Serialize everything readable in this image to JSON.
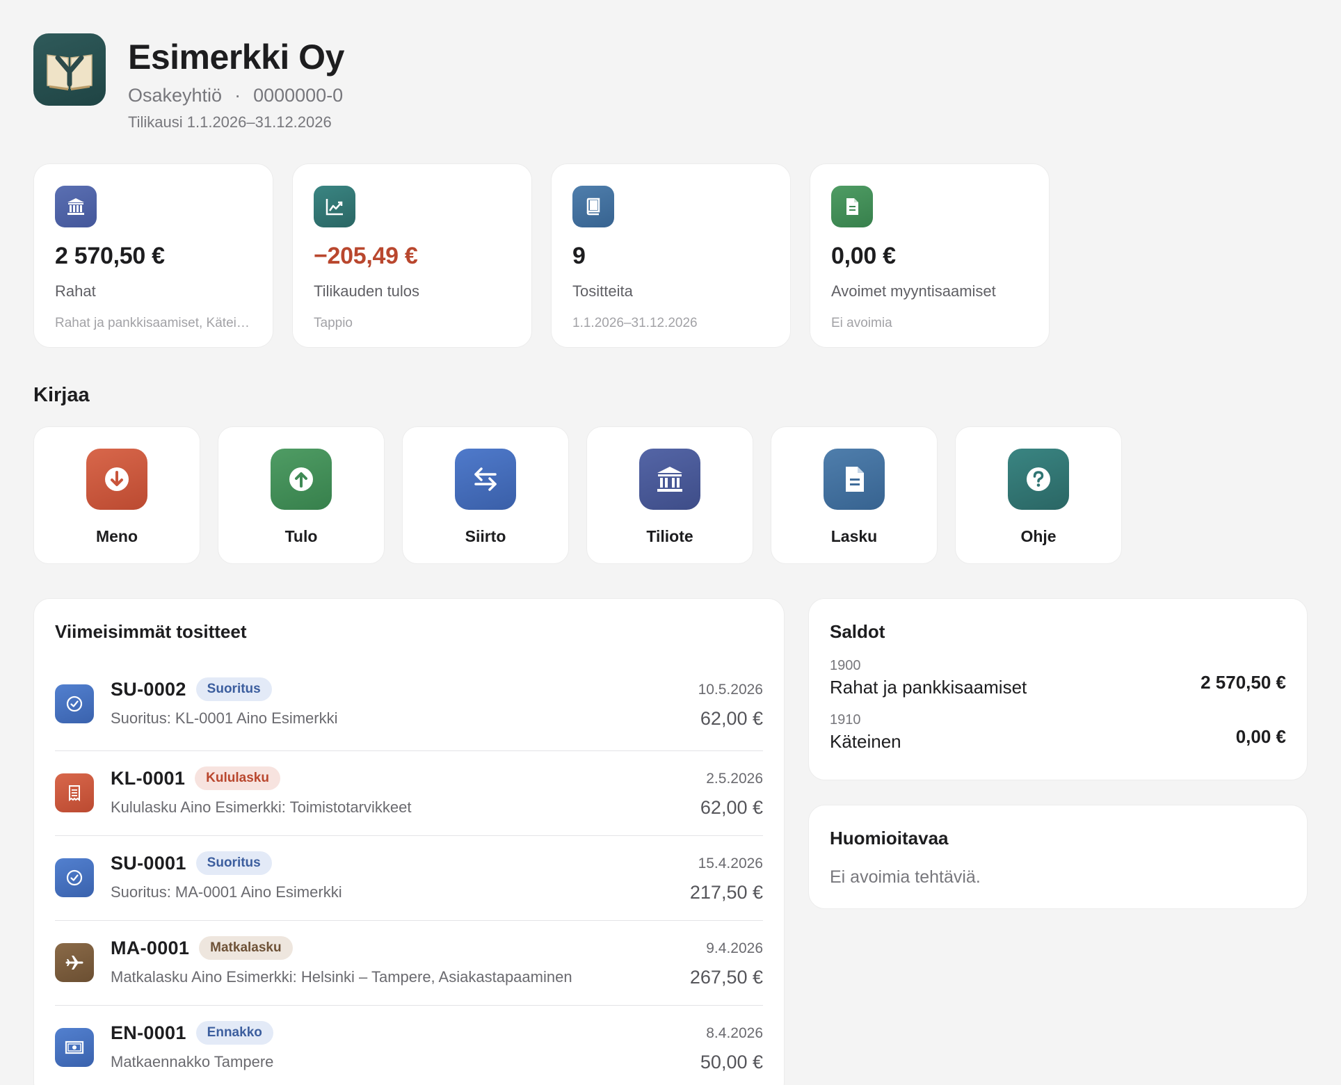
{
  "company": {
    "name": "Esimerkki Oy",
    "form": "Osakeyhtiö",
    "separator": "·",
    "business_id": "0000000-0",
    "period": "Tilikausi 1.1.2026–31.12.2026"
  },
  "stats": [
    {
      "icon": "bank-icon",
      "color": "#4a5fa0",
      "value": "2 570,50 €",
      "label": "Rahat",
      "sub": "Rahat ja pankkisaamiset, Käteinen"
    },
    {
      "icon": "chart-icon",
      "color": "#2f7472",
      "value": "−205,49 €",
      "label": "Tilikauden tulos",
      "sub": "Tappio"
    },
    {
      "icon": "book-icon",
      "color": "#3f6c9a",
      "value": "9",
      "label": "Tositteita",
      "sub": "1.1.2026–31.12.2026"
    },
    {
      "icon": "document-icon",
      "color": "#3f8a55",
      "value": "0,00 €",
      "label": "Avoimet myyntisaamiset",
      "sub": "Ei avoimia"
    }
  ],
  "actions_title": "Kirjaa",
  "actions": [
    {
      "label": "Meno",
      "icon": "arrow-down-icon",
      "color": "#c9553b"
    },
    {
      "label": "Tulo",
      "icon": "arrow-up-icon",
      "color": "#3f8a55"
    },
    {
      "label": "Siirto",
      "icon": "transfer-icon",
      "color": "#4169b5"
    },
    {
      "label": "Tiliote",
      "icon": "bank-icon",
      "color": "#4a5794"
    },
    {
      "label": "Lasku",
      "icon": "document-icon",
      "color": "#3f6c9a"
    },
    {
      "label": "Ohje",
      "icon": "question-icon",
      "color": "#2f7472"
    }
  ],
  "recent": {
    "title": "Viimeisimmät tositteet",
    "items": [
      {
        "code": "SU-0002",
        "badge": "Suoritus",
        "badge_style": "blue",
        "icon": "check-circle-icon",
        "color": "#4169b5",
        "desc": "Suoritus: KL-0001 Aino Esimerkki",
        "date": "10.5.2026",
        "amount": "62,00 €"
      },
      {
        "code": "KL-0001",
        "badge": "Kululasku",
        "badge_style": "red",
        "icon": "receipt-icon",
        "color": "#c9553b",
        "desc": "Kululasku Aino Esimerkki: Toimistotarvikkeet",
        "date": "2.5.2026",
        "amount": "62,00 €"
      },
      {
        "code": "SU-0001",
        "badge": "Suoritus",
        "badge_style": "blue",
        "icon": "check-circle-icon",
        "color": "#4169b5",
        "desc": "Suoritus: MA-0001 Aino Esimerkki",
        "date": "15.4.2026",
        "amount": "217,50 €"
      },
      {
        "code": "MA-0001",
        "badge": "Matkalasku",
        "badge_style": "brown",
        "icon": "airplane-icon",
        "color": "#7a5a3a",
        "desc": "Matkalasku Aino Esimerkki: Helsinki – Tampere, Asiakastapaaminen",
        "date": "9.4.2026",
        "amount": "267,50 €"
      },
      {
        "code": "EN-0001",
        "badge": "Ennakko",
        "badge_style": "blue",
        "icon": "banknote-icon",
        "color": "#4169b5",
        "desc": "Matkaennakko Tampere",
        "date": "8.4.2026",
        "amount": "50,00 €"
      }
    ]
  },
  "balances": {
    "title": "Saldot",
    "items": [
      {
        "number": "1900",
        "name": "Rahat ja pankkisaamiset",
        "value": "2 570,50 €"
      },
      {
        "number": "1910",
        "name": "Käteinen",
        "value": "0,00 €"
      }
    ]
  },
  "notes": {
    "title": "Huomioitavaa",
    "text": "Ei avoimia tehtäviä."
  }
}
